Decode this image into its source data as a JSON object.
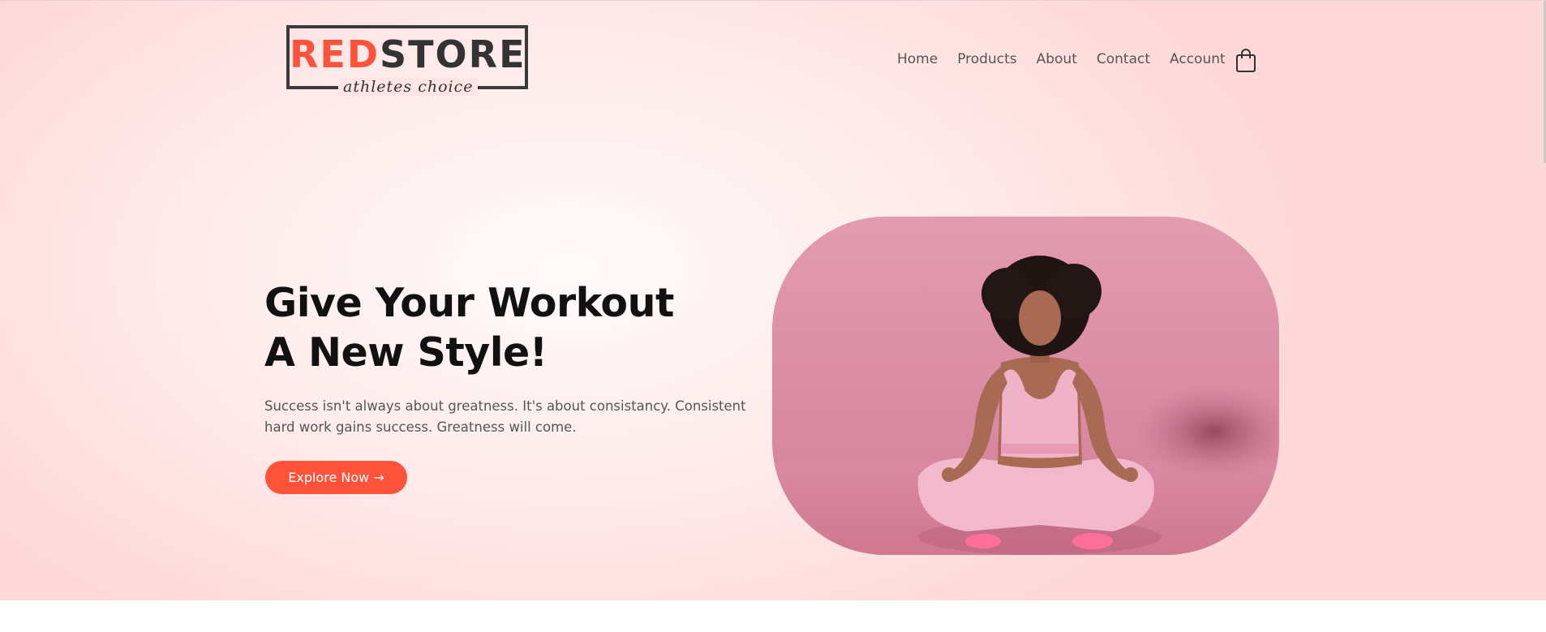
{
  "brand": {
    "name_red": "RED",
    "name_dark": "STORE",
    "tagline": "athletes choice",
    "accent_color": "#ff523b",
    "dark_color": "#333333"
  },
  "nav": {
    "items": [
      {
        "label": "Home"
      },
      {
        "label": "Products"
      },
      {
        "label": "About"
      },
      {
        "label": "Contact"
      },
      {
        "label": "Account"
      }
    ],
    "cart_icon": "shopping-bag-icon"
  },
  "hero": {
    "headline_line1": "Give Your Workout",
    "headline_line2": "A New Style!",
    "description": "Success isn't always about greatness. It's about consistancy. Consistent hard work gains success. Greatness will come.",
    "cta_label": "Explore Now →",
    "image_alt": "Woman in pink athletic wear meditating cross-legged on pink background"
  }
}
